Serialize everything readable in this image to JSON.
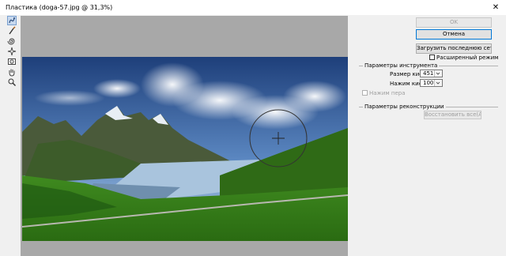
{
  "window": {
    "title": "Пластика (doga-57.jpg @ 31,3%)",
    "close_glyph": "✕"
  },
  "toolbox": [
    {
      "name": "forward-warp-tool",
      "icon": "forward-warp-icon",
      "active": true
    },
    {
      "name": "reconstruct-tool",
      "icon": "reconstruct-brush-icon"
    },
    {
      "name": "twirl-tool",
      "icon": "twirl-icon"
    },
    {
      "name": "pucker-tool",
      "icon": "pucker-icon"
    },
    {
      "name": "bloat-tool",
      "icon": "bloat-icon"
    },
    {
      "name": "hand-tool",
      "icon": "hand-icon"
    },
    {
      "name": "zoom-tool",
      "icon": "zoom-icon"
    }
  ],
  "buttons": {
    "ok": "OK",
    "cancel": "Отмена",
    "load_mesh": "Загрузить последнюю сетку",
    "restore_all": "Восстановить все(A)"
  },
  "advanced_mode": {
    "label": "Расширенный режим",
    "checked": false
  },
  "tool_options": {
    "title": "Параметры инструмента",
    "brush_size_label": "Размер кисти:",
    "brush_size_value": "451",
    "brush_pressure_label": "Нажим кисти:",
    "brush_pressure_value": "100",
    "stylus_pressure_label": "Нажим пера",
    "stylus_pressure_checked": false
  },
  "reconstruct_options": {
    "title": "Параметры реконструкции"
  },
  "colors": {
    "panel": "#f0f0f0",
    "canvas_bg": "#a8a8a8",
    "active_tool": "#c7d8ee",
    "focus_border": "#0078d7"
  }
}
